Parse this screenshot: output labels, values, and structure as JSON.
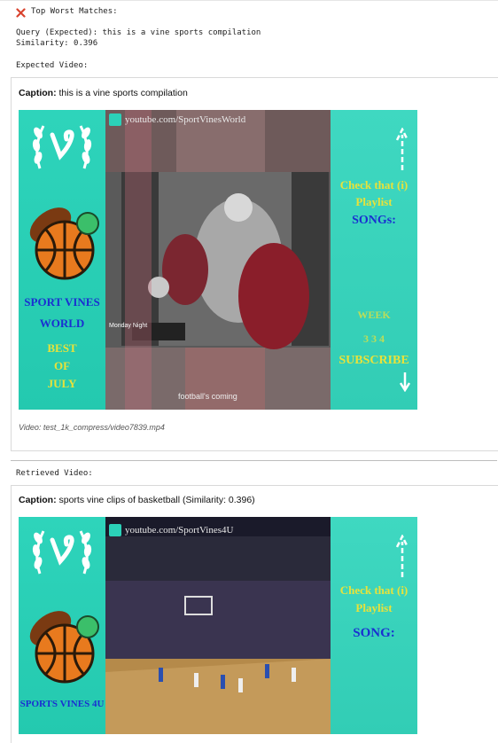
{
  "header": {
    "title": "Top Worst Matches:",
    "icon": "close-x-icon",
    "icon_color": "#d9432e"
  },
  "query": {
    "line": "Query (Expected): this is a vine sports compilation",
    "similarity_line": "Similarity: 0.396"
  },
  "expected_section": {
    "heading": "Expected Video:",
    "caption_label": "Caption:",
    "caption_text": "this is a vine sports compilation",
    "video": {
      "watermark": "youtube.com/SportVinesWorld",
      "left_text_1": "SPORT VINES",
      "left_text_2": "WORLD",
      "left_text_3": "BEST",
      "left_text_4": "OF",
      "left_text_5": "JULY",
      "right_text_1": "Check that (i)",
      "right_text_2": "Playlist",
      "right_text_3": "SONGs:",
      "right_text_4": "WEEK",
      "right_text_5": "3 3 4",
      "right_text_6": "SUBSCRIBE",
      "bottom_caption": "football's coming",
      "inset_label": "Monday Night"
    },
    "file_label": "Video: test_1k_compress/video7839.mp4"
  },
  "retrieved_section": {
    "heading": "Retrieved Video:",
    "caption_label": "Caption:",
    "caption_text": "sports vine clips of basketball (Similarity: 0.396)",
    "video": {
      "watermark": "youtube.com/SportVines4U",
      "left_text_1": "SPORTS VINES 4U",
      "right_text_1": "Check that (i)",
      "right_text_2": "Playlist",
      "right_text_3": "SONG:"
    }
  },
  "colors": {
    "teal": "#2bd1b8",
    "yellow_text": "#e8e23a",
    "blue_text": "#1a2fd1",
    "close_icon": "#d9432e"
  }
}
